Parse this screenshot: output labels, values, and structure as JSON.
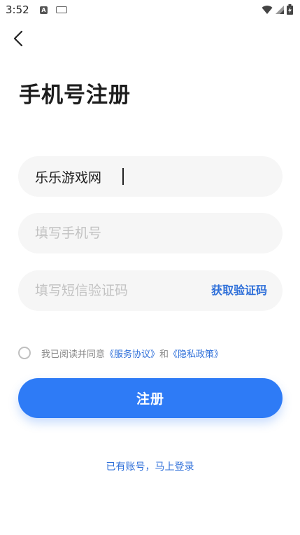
{
  "status_bar": {
    "time": "3:52",
    "notif_a": "A"
  },
  "page": {
    "title": "手机号注册"
  },
  "form": {
    "username_value": "乐乐游戏网",
    "phone_placeholder": "填写手机号",
    "code_placeholder": "填写短信验证码",
    "get_code_label": "获取验证码"
  },
  "agreement": {
    "prefix": "我已阅读并同意",
    "service_link": "《服务协议》",
    "and": "和",
    "privacy_link": "《隐私政策》"
  },
  "submit_label": "注册",
  "login_link": "已有账号，马上登录",
  "colors": {
    "accent": "#2e7bf6",
    "link": "#2e6fd9",
    "field_bg": "#f6f6f6"
  }
}
